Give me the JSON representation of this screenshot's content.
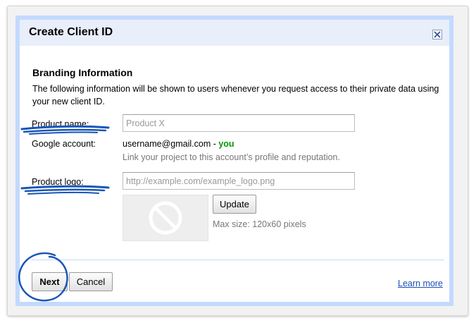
{
  "dialog": {
    "title": "Create Client ID",
    "close_icon": "close-icon"
  },
  "branding": {
    "section_title": "Branding Information",
    "description": "The following information will be shown to users whenever you request access to their private data using your new client ID."
  },
  "fields": {
    "product_name_label": "Product name:",
    "product_name_placeholder": "Product X",
    "product_name_value": "",
    "google_account_label": "Google account:",
    "google_account_email": "username@gmail.com",
    "google_account_sep": " - ",
    "google_account_you": "you",
    "google_account_hint": "Link your project to this account’s profile and reputation.",
    "product_logo_label": "Product logo:",
    "product_logo_placeholder": "http://example.com/example_logo.png",
    "product_logo_value": "",
    "logo_preview_icon": "no-image-icon",
    "update_label": "Update",
    "max_size": "Max size: 120x60 pixels"
  },
  "footer": {
    "next_label": "Next",
    "cancel_label": "Cancel",
    "learn_more": "Learn more"
  },
  "colors": {
    "dialog_border": "#c3d9ff",
    "header_bg": "#e8eefa",
    "annotation_ink": "#1a56b8",
    "you_green": "#009900",
    "link_blue": "#1c4fb4"
  }
}
